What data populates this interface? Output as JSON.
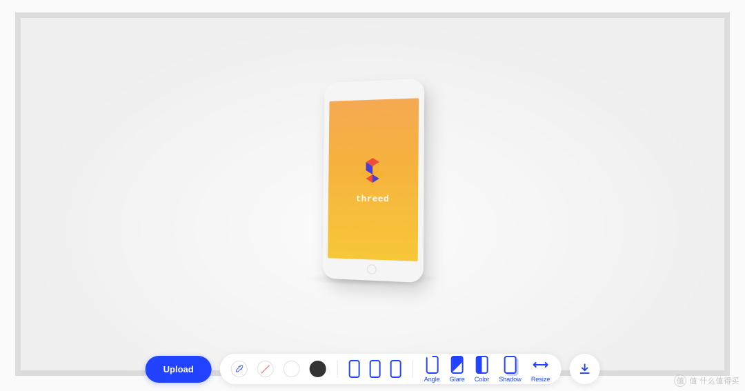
{
  "mockup": {
    "brand_text": "threed"
  },
  "toolbar": {
    "upload_label": "Upload",
    "tools": {
      "angle": "Angle",
      "glare": "Glare",
      "color": "Color",
      "shadow": "Shadow",
      "resize": "Resize"
    }
  },
  "watermark": {
    "logo_char": "值",
    "text": "值 什么值得买"
  },
  "colors": {
    "primary": "#2142ff",
    "swatches": [
      "eyedropper",
      "none",
      "#ffffff",
      "#333333"
    ]
  }
}
